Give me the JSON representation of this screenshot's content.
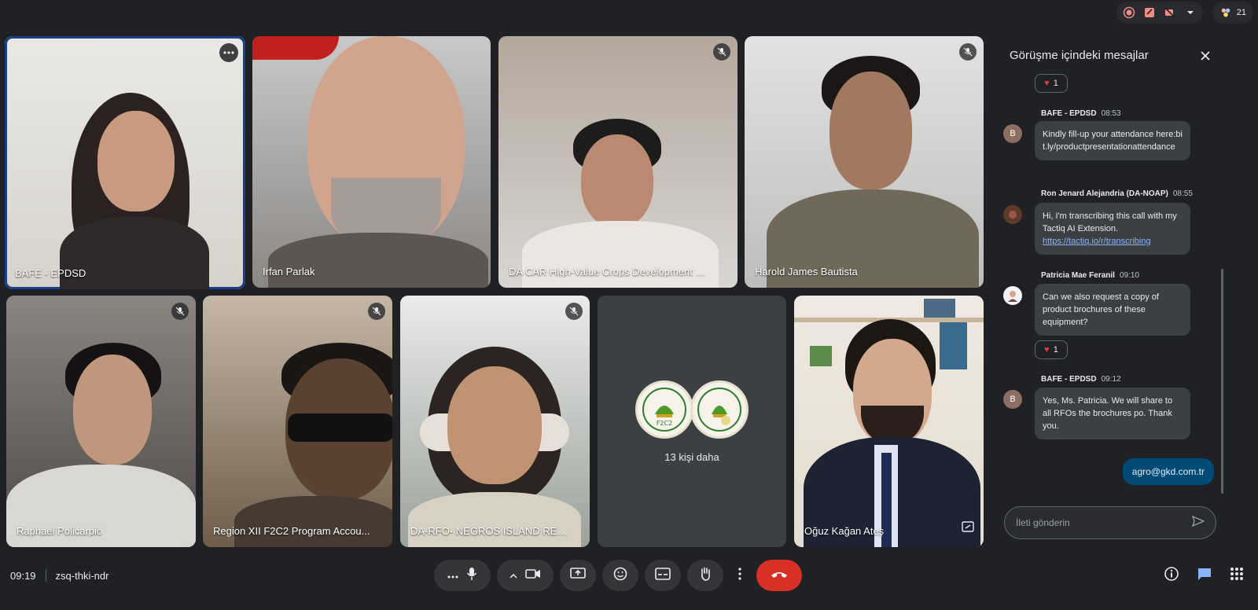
{
  "top_status": {
    "icons": [
      "record-icon",
      "activity-icon",
      "no-video-icon",
      "chevron-down-icon"
    ],
    "participants_count": "21"
  },
  "tiles": [
    {
      "name": "BAFE - EPDSD",
      "active": true,
      "muted": false,
      "has_more": true
    },
    {
      "name": "Irfan Parlak",
      "muted": false
    },
    {
      "name": "DA CAR High-Value Crops Development Pr...",
      "muted": true
    },
    {
      "name": "Harold James Bautista",
      "muted": true
    },
    {
      "name": "Raphael Policarpio",
      "muted": true
    },
    {
      "name": "Region XII F2C2 Program Accou...",
      "muted": true
    },
    {
      "name": "DA-RFO- NEGROS ISLAND REGI...",
      "muted": true
    },
    {
      "name": "Oğuz Kağan Ateş",
      "muted": false
    }
  ],
  "others_tile": {
    "label": "13 kişi daha",
    "logo_text_1": "F2C2"
  },
  "chat": {
    "title": "Görüşme içindeki mesajlar",
    "messages": [
      {
        "reaction": "1"
      },
      {
        "sender": "BAFE - EPDSD",
        "time": "08:53",
        "initial": "B",
        "text": "Kindly fill-up your attendance here:bit.ly/productpresentationattendance"
      },
      {
        "sender": "Ron Jenard Alejandria (DA-NOAP)",
        "time": "08:55",
        "text": "Hi, I'm transcribing this call with my Tactiq AI Extension.",
        "link": "https://tactiq.io/r/transcribing"
      },
      {
        "sender": "Patricia Mae Feranil",
        "time": "09:10",
        "text": "Can we also request a copy of product brochures of these equipment?",
        "reaction": "1"
      },
      {
        "sender": "BAFE - EPDSD",
        "time": "09:12",
        "initial": "B",
        "text": "Yes, Ms. Patricia. We will share to all RFOs the brochures po. Thank you."
      },
      {
        "mine": true,
        "text": "agro@gkd.com.tr"
      }
    ],
    "input_placeholder": "İleti gönderin"
  },
  "bottom": {
    "clock": "09:19",
    "meeting_code": "zsq-thki-ndr"
  },
  "colors": {
    "background": "#202124",
    "tile": "#3c4043",
    "end_call": "#d93025",
    "active_border": "#1a3f8a",
    "link": "#8ab4f8",
    "own_message": "#004a77"
  }
}
